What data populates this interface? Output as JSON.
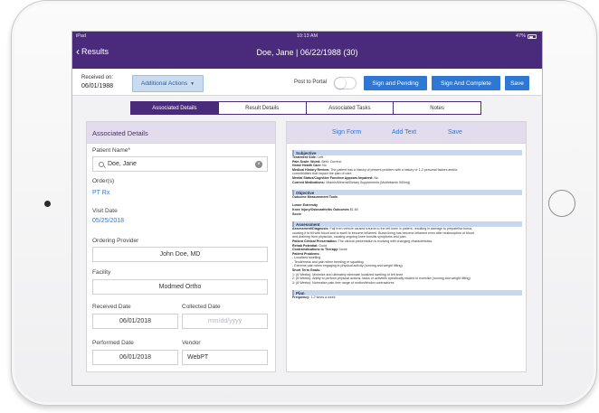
{
  "status_bar": {
    "device": "iPad",
    "time": "10:13 AM",
    "battery": "47%"
  },
  "nav": {
    "back_label": "Results",
    "title": "Doe, Jane | 06/22/1988 (30)"
  },
  "action_bar": {
    "received_on_label": "Received on:",
    "received_on_date": "06/01/1988",
    "additional_actions_label": "Additional Actions",
    "post_to_portal_label": "Post to Portal",
    "post_to_portal_on": false,
    "sign_pending_label": "Sign and Pending",
    "sign_complete_label": "Sign And Complete",
    "save_label": "Save"
  },
  "tabs": [
    {
      "label": "Associated Details",
      "active": true
    },
    {
      "label": "Result Details",
      "active": false
    },
    {
      "label": "Associated Tasks",
      "active": false
    },
    {
      "label": "Notes",
      "active": false
    }
  ],
  "details": {
    "header": "Associated Details",
    "patient_name_label": "Patient Name*",
    "patient_name_value": "Doe, Jane",
    "orders_label": "Order(s)",
    "orders_value": "PT Rx",
    "visit_date_label": "Visit Date",
    "visit_date_value": "05/25/2018",
    "ordering_provider_label": "Ordering Provider",
    "ordering_provider_value": "John Doe, MD",
    "facility_label": "Facility",
    "facility_value": "Modmed Ortho",
    "received_date_label": "Received Date",
    "received_date_value": "06/01/2018",
    "collected_date_label": "Collected Date",
    "collected_date_placeholder": "mm/dd/yyyy",
    "performed_date_label": "Performed Date",
    "performed_date_value": "06/01/2018",
    "vendor_label": "Vendor",
    "vendor_value": "WebPT"
  },
  "document_toolbar": {
    "sign_form": "Sign Form",
    "add_text": "Add Text",
    "save": "Save"
  },
  "document": {
    "subjective": {
      "title": "Subjective",
      "lines": [
        [
          "Treatment Side:",
          "Left"
        ],
        [
          "Pain Scale: Worst:",
          "Best:  Current:"
        ],
        [
          "Home Health Care:",
          "No"
        ],
        [
          "Medical History Review:",
          "The patient has a history of present problem with a history or 1-2 personal factors and/or"
        ],
        [
          "",
          "comorbidities that impact the plan of care."
        ],
        [
          "Mental Status/Cognitive Function Appears Impaired:",
          "No"
        ],
        [
          "Current Medications:",
          "Vitamin/Mineral/Dietary Supplements (Multivitamin 500mg)"
        ]
      ]
    },
    "objective": {
      "title": "Objective",
      "lines": [
        [
          "Outcome Measurement Tools",
          ""
        ],
        [
          "",
          ""
        ],
        [
          "Lower Extremity",
          ""
        ],
        [
          "Knee Injury/Osteoarthritis Outcomes",
          "$1.60"
        ],
        [
          "Score",
          ""
        ]
      ]
    },
    "assessment": {
      "title": "Assessment",
      "lines": [
        [
          "Assessment/Diagnosis:",
          "Fall from vehicle caused trauma to the left knee in patient, resulting in damage to prepatellar bursa,"
        ],
        [
          "",
          "causing it to fill with blood and to swell to become inflamed. Bursa lining has become inflamed even after reabsorption of blood"
        ],
        [
          "",
          "and draining from physician, causing ongoing knee bursitis symptoms and pain."
        ],
        [
          "Patient Clinical Presentation:",
          "The clinical presentation is evolving with changing characteristics."
        ],
        [
          "Rehab Potential:",
          "Good"
        ],
        [
          "Contraindications to Therapy:",
          "None"
        ],
        [
          "Patient Problems:",
          ""
        ],
        [
          "",
          "- Localized swelling"
        ],
        [
          "",
          "- Tenderness and pain when bending or squatting"
        ],
        [
          "",
          "- Extreme pain when engaging in physical activity (running and weight lifting)"
        ],
        [
          "Short Term Goals:",
          ""
        ],
        [
          "",
          "1: (6 Weeks): Minimize and ultimately eliminate localized swelling of left knee"
        ],
        [
          "",
          "2: (8 Weeks): Ability to perform physical actions, tasks or activities specifically related to exercise (running and weight lifting)"
        ],
        [
          "",
          "3: (8 Weeks): Normalize pain-free range of motion/tendon contractures"
        ]
      ]
    },
    "plan": {
      "title": "Plan",
      "lines": [
        [
          "Frequency:",
          "1-2 times a week"
        ]
      ]
    }
  },
  "colors": {
    "brand_purple": "#4a2a7a",
    "action_blue": "#2e78d4",
    "panel_header": "#e2dcec",
    "section_bar": "#c8d6ee"
  }
}
